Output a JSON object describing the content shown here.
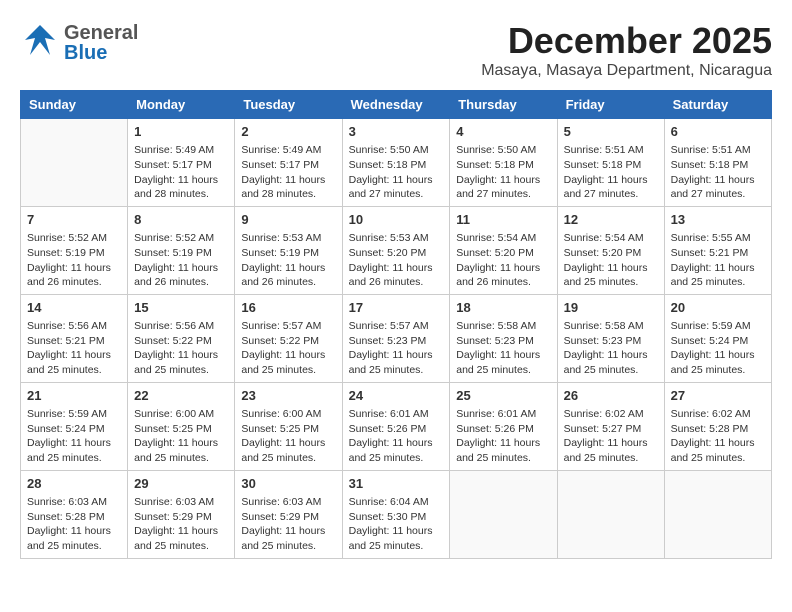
{
  "header": {
    "logo_general": "General",
    "logo_blue": "Blue",
    "month": "December 2025",
    "location": "Masaya, Masaya Department, Nicaragua"
  },
  "days_of_week": [
    "Sunday",
    "Monday",
    "Tuesday",
    "Wednesday",
    "Thursday",
    "Friday",
    "Saturday"
  ],
  "weeks": [
    [
      {
        "day": "",
        "info": ""
      },
      {
        "day": "1",
        "info": "Sunrise: 5:49 AM\nSunset: 5:17 PM\nDaylight: 11 hours\nand 28 minutes."
      },
      {
        "day": "2",
        "info": "Sunrise: 5:49 AM\nSunset: 5:17 PM\nDaylight: 11 hours\nand 28 minutes."
      },
      {
        "day": "3",
        "info": "Sunrise: 5:50 AM\nSunset: 5:18 PM\nDaylight: 11 hours\nand 27 minutes."
      },
      {
        "day": "4",
        "info": "Sunrise: 5:50 AM\nSunset: 5:18 PM\nDaylight: 11 hours\nand 27 minutes."
      },
      {
        "day": "5",
        "info": "Sunrise: 5:51 AM\nSunset: 5:18 PM\nDaylight: 11 hours\nand 27 minutes."
      },
      {
        "day": "6",
        "info": "Sunrise: 5:51 AM\nSunset: 5:18 PM\nDaylight: 11 hours\nand 27 minutes."
      }
    ],
    [
      {
        "day": "7",
        "info": "Sunrise: 5:52 AM\nSunset: 5:19 PM\nDaylight: 11 hours\nand 26 minutes."
      },
      {
        "day": "8",
        "info": "Sunrise: 5:52 AM\nSunset: 5:19 PM\nDaylight: 11 hours\nand 26 minutes."
      },
      {
        "day": "9",
        "info": "Sunrise: 5:53 AM\nSunset: 5:19 PM\nDaylight: 11 hours\nand 26 minutes."
      },
      {
        "day": "10",
        "info": "Sunrise: 5:53 AM\nSunset: 5:20 PM\nDaylight: 11 hours\nand 26 minutes."
      },
      {
        "day": "11",
        "info": "Sunrise: 5:54 AM\nSunset: 5:20 PM\nDaylight: 11 hours\nand 26 minutes."
      },
      {
        "day": "12",
        "info": "Sunrise: 5:54 AM\nSunset: 5:20 PM\nDaylight: 11 hours\nand 25 minutes."
      },
      {
        "day": "13",
        "info": "Sunrise: 5:55 AM\nSunset: 5:21 PM\nDaylight: 11 hours\nand 25 minutes."
      }
    ],
    [
      {
        "day": "14",
        "info": "Sunrise: 5:56 AM\nSunset: 5:21 PM\nDaylight: 11 hours\nand 25 minutes."
      },
      {
        "day": "15",
        "info": "Sunrise: 5:56 AM\nSunset: 5:22 PM\nDaylight: 11 hours\nand 25 minutes."
      },
      {
        "day": "16",
        "info": "Sunrise: 5:57 AM\nSunset: 5:22 PM\nDaylight: 11 hours\nand 25 minutes."
      },
      {
        "day": "17",
        "info": "Sunrise: 5:57 AM\nSunset: 5:23 PM\nDaylight: 11 hours\nand 25 minutes."
      },
      {
        "day": "18",
        "info": "Sunrise: 5:58 AM\nSunset: 5:23 PM\nDaylight: 11 hours\nand 25 minutes."
      },
      {
        "day": "19",
        "info": "Sunrise: 5:58 AM\nSunset: 5:23 PM\nDaylight: 11 hours\nand 25 minutes."
      },
      {
        "day": "20",
        "info": "Sunrise: 5:59 AM\nSunset: 5:24 PM\nDaylight: 11 hours\nand 25 minutes."
      }
    ],
    [
      {
        "day": "21",
        "info": "Sunrise: 5:59 AM\nSunset: 5:24 PM\nDaylight: 11 hours\nand 25 minutes."
      },
      {
        "day": "22",
        "info": "Sunrise: 6:00 AM\nSunset: 5:25 PM\nDaylight: 11 hours\nand 25 minutes."
      },
      {
        "day": "23",
        "info": "Sunrise: 6:00 AM\nSunset: 5:25 PM\nDaylight: 11 hours\nand 25 minutes."
      },
      {
        "day": "24",
        "info": "Sunrise: 6:01 AM\nSunset: 5:26 PM\nDaylight: 11 hours\nand 25 minutes."
      },
      {
        "day": "25",
        "info": "Sunrise: 6:01 AM\nSunset: 5:26 PM\nDaylight: 11 hours\nand 25 minutes."
      },
      {
        "day": "26",
        "info": "Sunrise: 6:02 AM\nSunset: 5:27 PM\nDaylight: 11 hours\nand 25 minutes."
      },
      {
        "day": "27",
        "info": "Sunrise: 6:02 AM\nSunset: 5:28 PM\nDaylight: 11 hours\nand 25 minutes."
      }
    ],
    [
      {
        "day": "28",
        "info": "Sunrise: 6:03 AM\nSunset: 5:28 PM\nDaylight: 11 hours\nand 25 minutes."
      },
      {
        "day": "29",
        "info": "Sunrise: 6:03 AM\nSunset: 5:29 PM\nDaylight: 11 hours\nand 25 minutes."
      },
      {
        "day": "30",
        "info": "Sunrise: 6:03 AM\nSunset: 5:29 PM\nDaylight: 11 hours\nand 25 minutes."
      },
      {
        "day": "31",
        "info": "Sunrise: 6:04 AM\nSunset: 5:30 PM\nDaylight: 11 hours\nand 25 minutes."
      },
      {
        "day": "",
        "info": ""
      },
      {
        "day": "",
        "info": ""
      },
      {
        "day": "",
        "info": ""
      }
    ]
  ]
}
